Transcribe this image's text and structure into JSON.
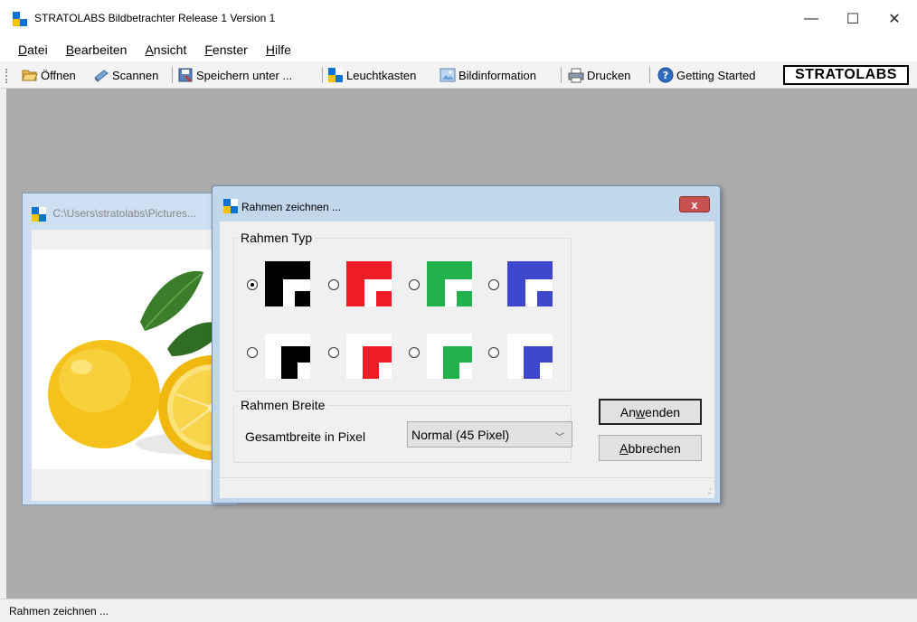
{
  "window": {
    "title": "STRATOLABS Bildbetrachter Release 1 Version 1",
    "controls": {
      "minimize": "—",
      "maximize": "☐",
      "close": "✕"
    }
  },
  "menu": [
    {
      "label": "Datei",
      "accel": "D"
    },
    {
      "label": "Bearbeiten",
      "accel": "B"
    },
    {
      "label": "Ansicht",
      "accel": "A"
    },
    {
      "label": "Fenster",
      "accel": "F"
    },
    {
      "label": "Hilfe",
      "accel": "H"
    }
  ],
  "toolbar": {
    "open": "Öffnen",
    "scan": "Scannen",
    "save_as": "Speichern unter ...",
    "lightbox": "Leuchtkasten",
    "image_info": "Bildinformation",
    "print": "Drucken",
    "getting_started": "Getting Started",
    "brand": "STRATOLABS"
  },
  "child_window": {
    "title": "C:\\Users\\stratolabs\\Pictures..."
  },
  "dialog": {
    "title": "Rahmen zeichnen ...",
    "close_label": "x",
    "frame_type_legend": "Rahmen Typ",
    "frame_colors": {
      "black": "#000000",
      "red": "#ee1c25",
      "green": "#22b14c",
      "blue": "#3f48cc"
    },
    "selected_frame": "black-full",
    "frame_width_legend": "Rahmen Breite",
    "width_label": "Gesamtbreite in Pixel",
    "width_value": "Normal (45 Pixel)",
    "apply_label": "Anwenden",
    "cancel_label": "Abbrechen"
  },
  "status": {
    "text": "Rahmen zeichnen ..."
  }
}
